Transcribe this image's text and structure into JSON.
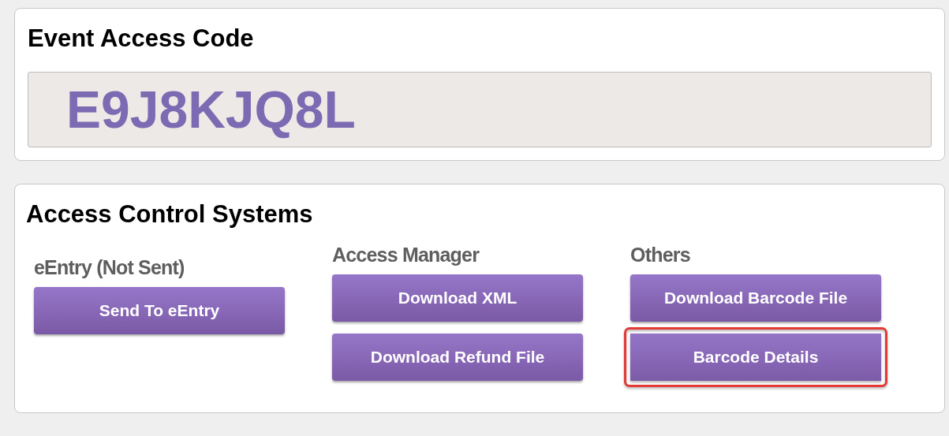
{
  "access_code": {
    "title": "Event Access Code",
    "value": "E9J8KJQ8L"
  },
  "access_control": {
    "title": "Access Control Systems",
    "columns": [
      {
        "heading": "eEntry (Not Sent)",
        "buttons": [
          {
            "label": "Send To eEntry",
            "highlighted": false
          }
        ]
      },
      {
        "heading": "Access Manager",
        "buttons": [
          {
            "label": "Download XML",
            "highlighted": false
          },
          {
            "label": "Download Refund File",
            "highlighted": false
          }
        ]
      },
      {
        "heading": "Others",
        "buttons": [
          {
            "label": "Download Barcode File",
            "highlighted": false
          },
          {
            "label": "Barcode Details",
            "highlighted": true
          }
        ]
      }
    ]
  }
}
